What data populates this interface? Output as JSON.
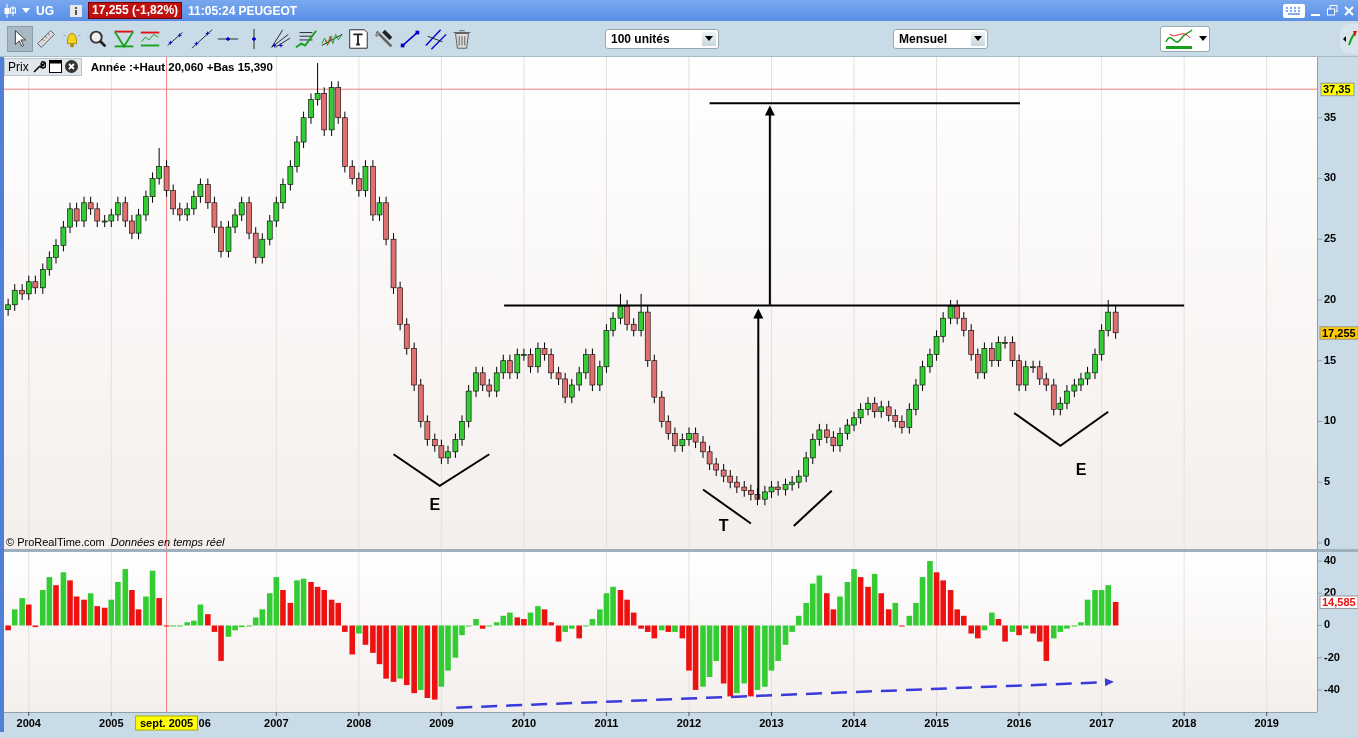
{
  "title_bar": {
    "symbol": "UG",
    "quote": "17,255 (-1,82%)",
    "time": "11:05:24",
    "name": "PEUGEOT"
  },
  "toolbar": {
    "tools": [
      {
        "kind": "pointer",
        "selected": true
      },
      {
        "kind": "ruler",
        "selected": false
      },
      {
        "kind": "alert",
        "selected": false
      },
      {
        "kind": "zoom",
        "selected": false
      },
      {
        "kind": "triangle",
        "selected": false
      },
      {
        "kind": "channel",
        "selected": false
      },
      {
        "kind": "segment",
        "selected": false
      },
      {
        "kind": "line",
        "selected": false
      },
      {
        "kind": "horizontal",
        "selected": false
      },
      {
        "kind": "vertical",
        "selected": false
      },
      {
        "kind": "fan",
        "selected": false
      },
      {
        "kind": "regression",
        "selected": false
      },
      {
        "kind": "zigzag",
        "selected": false
      },
      {
        "kind": "text",
        "selected": false
      },
      {
        "kind": "tools",
        "selected": false
      },
      {
        "kind": "point",
        "selected": false
      },
      {
        "kind": "parallel",
        "selected": false
      },
      {
        "kind": "trash",
        "selected": false
      }
    ],
    "quantity": {
      "value": "100 unités"
    },
    "period": {
      "value": "Mensuel"
    }
  },
  "price_panel": {
    "tab": "Prix",
    "info": "Année :+Haut 20,060 +Bas 15,390",
    "credit": "© ProRealTime.com",
    "credit_note": "Données en temps réel",
    "cursor_label": "37,35",
    "last_label": "17,255",
    "pattern_labels": [
      "E",
      "T",
      "E"
    ],
    "chart_data": {
      "type": "candlestick",
      "grid": true,
      "ref_lines": [
        {
          "axis": "y",
          "value": 37.35
        },
        {
          "axis": "x",
          "value": 2005.67
        },
        {
          "axis": "y",
          "value": 19.55
        }
      ],
      "xlim": [
        2003.7,
        2019.61
      ],
      "ylim": [
        -0.5,
        40
      ],
      "yticks": [
        0,
        5,
        10,
        15,
        20,
        25,
        30,
        35
      ],
      "x": [
        2003.75,
        2003.83,
        2003.92,
        2004,
        2004.08,
        2004.17,
        2004.25,
        2004.33,
        2004.42,
        2004.5,
        2004.58,
        2004.67,
        2004.75,
        2004.83,
        2004.92,
        2005,
        2005.08,
        2005.17,
        2005.25,
        2005.33,
        2005.42,
        2005.5,
        2005.58,
        2005.67,
        2005.75,
        2005.83,
        2005.92,
        2006,
        2006.08,
        2006.17,
        2006.25,
        2006.33,
        2006.42,
        2006.5,
        2006.58,
        2006.67,
        2006.75,
        2006.83,
        2006.92,
        2007,
        2007.08,
        2007.17,
        2007.25,
        2007.33,
        2007.42,
        2007.5,
        2007.58,
        2007.67,
        2007.75,
        2007.83,
        2007.92,
        2008,
        2008.08,
        2008.17,
        2008.25,
        2008.33,
        2008.42,
        2008.5,
        2008.58,
        2008.67,
        2008.75,
        2008.83,
        2008.92,
        2009,
        2009.08,
        2009.17,
        2009.25,
        2009.33,
        2009.42,
        2009.5,
        2009.58,
        2009.67,
        2009.75,
        2009.83,
        2009.92,
        2010,
        2010.08,
        2010.17,
        2010.25,
        2010.33,
        2010.42,
        2010.5,
        2010.58,
        2010.67,
        2010.75,
        2010.83,
        2010.92,
        2011,
        2011.08,
        2011.17,
        2011.25,
        2011.33,
        2011.42,
        2011.5,
        2011.58,
        2011.67,
        2011.75,
        2011.83,
        2011.92,
        2012,
        2012.08,
        2012.17,
        2012.25,
        2012.33,
        2012.42,
        2012.5,
        2012.58,
        2012.67,
        2012.75,
        2012.83,
        2012.92,
        2013,
        2013.08,
        2013.17,
        2013.25,
        2013.33,
        2013.42,
        2013.5,
        2013.58,
        2013.67,
        2013.75,
        2013.83,
        2013.92,
        2014,
        2014.08,
        2014.17,
        2014.25,
        2014.33,
        2014.42,
        2014.5,
        2014.58,
        2014.67,
        2014.75,
        2014.83,
        2014.92,
        2015,
        2015.08,
        2015.17,
        2015.25,
        2015.33,
        2015.42,
        2015.5,
        2015.58,
        2015.67,
        2015.75,
        2015.83,
        2015.92,
        2016,
        2016.08,
        2016.17,
        2016.25,
        2016.33,
        2016.42,
        2016.5,
        2016.58,
        2016.67,
        2016.75,
        2016.83,
        2016.92,
        2017,
        2017.08,
        2017.17
      ],
      "ohlc": [
        [
          19.2,
          20.1,
          18.7,
          19.6
        ],
        [
          19.6,
          21.3,
          19.1,
          20.8
        ],
        [
          20.8,
          21.3,
          20.0,
          20.5
        ],
        [
          20.5,
          22.0,
          20.0,
          21.5
        ],
        [
          21.5,
          22.0,
          20.5,
          21.0
        ],
        [
          21.0,
          23.0,
          20.5,
          22.5
        ],
        [
          22.5,
          24.0,
          22.0,
          23.5
        ],
        [
          23.5,
          25.0,
          23.0,
          24.5
        ],
        [
          24.5,
          26.5,
          24.0,
          26.0
        ],
        [
          26.0,
          28.0,
          25.5,
          27.5
        ],
        [
          27.5,
          28.0,
          26.0,
          26.5
        ],
        [
          26.5,
          28.5,
          26.0,
          28.0
        ],
        [
          28.0,
          28.5,
          27.0,
          27.5
        ],
        [
          27.5,
          28.0,
          26.0,
          26.5
        ],
        [
          26.5,
          27.0,
          26.0,
          26.5
        ],
        [
          26.5,
          27.5,
          26.0,
          27.0
        ],
        [
          27.0,
          28.5,
          26.5,
          28.0
        ],
        [
          28.0,
          28.5,
          26.0,
          26.5
        ],
        [
          26.5,
          27.0,
          25.0,
          25.5
        ],
        [
          25.5,
          27.5,
          25.0,
          27.0
        ],
        [
          27.0,
          29.0,
          26.5,
          28.5
        ],
        [
          28.5,
          30.5,
          28.0,
          30.0
        ],
        [
          30.0,
          32.5,
          29.5,
          31.0
        ],
        [
          31.0,
          31.5,
          28.5,
          29.0
        ],
        [
          29.0,
          29.5,
          27.0,
          27.5
        ],
        [
          27.5,
          28.0,
          26.5,
          27.0
        ],
        [
          27.0,
          28.0,
          26.5,
          27.5
        ],
        [
          27.5,
          29.0,
          27.0,
          28.5
        ],
        [
          28.5,
          30.0,
          28.0,
          29.5
        ],
        [
          29.5,
          30.0,
          27.5,
          28.0
        ],
        [
          28.0,
          28.5,
          25.5,
          26.0
        ],
        [
          26.0,
          26.5,
          23.5,
          24.0
        ],
        [
          24.0,
          26.5,
          23.5,
          26.0
        ],
        [
          26.0,
          27.5,
          25.5,
          27.0
        ],
        [
          27.0,
          28.5,
          26.5,
          28.0
        ],
        [
          28.0,
          28.5,
          25.0,
          25.5
        ],
        [
          25.5,
          26.0,
          23.0,
          23.5
        ],
        [
          23.5,
          25.5,
          23.0,
          25.0
        ],
        [
          25.0,
          27.0,
          24.5,
          26.5
        ],
        [
          26.5,
          28.5,
          26.0,
          28.0
        ],
        [
          28.0,
          30.0,
          27.5,
          29.5
        ],
        [
          29.5,
          31.5,
          29.0,
          31.0
        ],
        [
          31.0,
          33.5,
          30.5,
          33.0
        ],
        [
          33.0,
          35.5,
          32.5,
          35.0
        ],
        [
          35.0,
          37.0,
          34.5,
          36.5
        ],
        [
          36.5,
          39.5,
          36.0,
          37.0
        ],
        [
          37.0,
          37.5,
          33.5,
          34.0
        ],
        [
          34.0,
          38.0,
          33.5,
          37.5
        ],
        [
          37.5,
          38.0,
          34.5,
          35.0
        ],
        [
          35.0,
          35.5,
          30.5,
          31.0
        ],
        [
          31.0,
          31.5,
          29.5,
          30.0
        ],
        [
          30.0,
          30.5,
          28.5,
          29.0
        ],
        [
          29.0,
          31.5,
          28.5,
          31.0
        ],
        [
          31.0,
          31.5,
          26.5,
          27.0
        ],
        [
          27.0,
          28.5,
          26.5,
          28.0
        ],
        [
          28.0,
          28.5,
          24.5,
          25.0
        ],
        [
          25.0,
          25.5,
          20.5,
          21.0
        ],
        [
          21.0,
          21.5,
          17.5,
          18.0
        ],
        [
          18.0,
          18.5,
          15.5,
          16.0
        ],
        [
          16.0,
          16.5,
          12.5,
          13.0
        ],
        [
          13.0,
          13.5,
          9.5,
          10.0
        ],
        [
          10.0,
          10.5,
          8.0,
          8.5
        ],
        [
          8.5,
          9.0,
          7.5,
          8.0
        ],
        [
          8.0,
          8.5,
          6.5,
          7.0
        ],
        [
          7.0,
          8.0,
          6.5,
          7.5
        ],
        [
          7.5,
          9.0,
          7.0,
          8.5
        ],
        [
          8.5,
          10.5,
          8.0,
          10.0
        ],
        [
          10.0,
          13.0,
          9.5,
          12.5
        ],
        [
          12.5,
          14.5,
          12.0,
          14.0
        ],
        [
          14.0,
          14.5,
          12.5,
          13.0
        ],
        [
          13.0,
          13.5,
          12.0,
          12.5
        ],
        [
          12.5,
          14.5,
          12.0,
          14.0
        ],
        [
          14.0,
          15.5,
          13.5,
          15.0
        ],
        [
          15.0,
          15.5,
          13.5,
          14.0
        ],
        [
          14.0,
          16.0,
          13.5,
          15.5
        ],
        [
          15.5,
          16.0,
          15.0,
          15.5
        ],
        [
          15.5,
          16.0,
          14.0,
          14.5
        ],
        [
          14.5,
          16.5,
          14.0,
          16.0
        ],
        [
          16.0,
          16.5,
          15.0,
          15.5
        ],
        [
          15.5,
          16.0,
          13.5,
          14.0
        ],
        [
          14.0,
          14.5,
          13.0,
          13.5
        ],
        [
          13.5,
          14.0,
          11.5,
          12.0
        ],
        [
          12.0,
          13.5,
          11.5,
          13.0
        ],
        [
          13.0,
          14.5,
          12.5,
          14.0
        ],
        [
          14.0,
          16.0,
          13.5,
          15.5
        ],
        [
          15.5,
          16.0,
          12.5,
          13.0
        ],
        [
          13.0,
          15.0,
          12.5,
          14.5
        ],
        [
          14.5,
          18.0,
          14.0,
          17.5
        ],
        [
          17.5,
          19.0,
          17.0,
          18.5
        ],
        [
          18.5,
          20.5,
          18.0,
          19.5
        ],
        [
          19.5,
          20.0,
          17.5,
          18.0
        ],
        [
          18.0,
          18.5,
          17.0,
          17.5
        ],
        [
          17.5,
          20.5,
          17.0,
          19.0
        ],
        [
          19.0,
          19.5,
          14.5,
          15.0
        ],
        [
          15.0,
          15.5,
          11.5,
          12.0
        ],
        [
          12.0,
          12.5,
          9.5,
          10.0
        ],
        [
          10.0,
          10.5,
          8.5,
          9.0
        ],
        [
          9.0,
          9.5,
          7.5,
          8.0
        ],
        [
          8.0,
          9.0,
          7.5,
          8.5
        ],
        [
          8.5,
          9.5,
          8.0,
          9.0
        ],
        [
          9.0,
          9.5,
          7.8,
          8.3
        ],
        [
          8.3,
          8.8,
          7.0,
          7.5
        ],
        [
          7.5,
          8.0,
          6.0,
          6.5
        ],
        [
          6.5,
          7.0,
          5.5,
          6.0
        ],
        [
          6.0,
          6.5,
          5.0,
          5.5
        ],
        [
          5.5,
          6.0,
          4.5,
          5.0
        ],
        [
          5.0,
          5.5,
          4.1,
          4.6
        ],
        [
          4.6,
          5.1,
          3.8,
          4.3
        ],
        [
          4.3,
          4.8,
          3.5,
          4.0
        ],
        [
          4.0,
          4.5,
          3.1,
          3.6
        ],
        [
          3.6,
          4.7,
          3.1,
          4.2
        ],
        [
          4.2,
          5.1,
          3.7,
          4.6
        ],
        [
          4.6,
          5.1,
          3.9,
          4.4
        ],
        [
          4.4,
          5.3,
          3.9,
          4.8
        ],
        [
          4.8,
          5.5,
          4.3,
          5.0
        ],
        [
          5.0,
          6.0,
          4.5,
          5.5
        ],
        [
          5.5,
          7.5,
          5.0,
          7.0
        ],
        [
          7.0,
          9.0,
          6.5,
          8.5
        ],
        [
          8.5,
          9.8,
          8.0,
          9.3
        ],
        [
          9.3,
          9.8,
          8.2,
          8.7
        ],
        [
          8.7,
          9.2,
          7.5,
          8.0
        ],
        [
          8.0,
          9.5,
          7.5,
          9.0
        ],
        [
          9.0,
          10.2,
          8.5,
          9.7
        ],
        [
          9.7,
          10.8,
          9.2,
          10.3
        ],
        [
          10.3,
          11.5,
          9.8,
          11.0
        ],
        [
          11.0,
          12.0,
          10.5,
          11.5
        ],
        [
          11.5,
          12.0,
          10.3,
          10.8
        ],
        [
          10.8,
          11.7,
          10.3,
          11.2
        ],
        [
          11.2,
          11.7,
          10.0,
          10.5
        ],
        [
          10.5,
          11.0,
          9.5,
          10.0
        ],
        [
          10.0,
          10.5,
          9.0,
          9.5
        ],
        [
          9.5,
          11.5,
          9.0,
          11.0
        ],
        [
          11.0,
          13.5,
          10.5,
          13.0
        ],
        [
          13.0,
          15.0,
          12.5,
          14.5
        ],
        [
          14.5,
          16.0,
          14.0,
          15.5
        ],
        [
          15.5,
          17.5,
          15.0,
          17.0
        ],
        [
          17.0,
          19.0,
          16.5,
          18.5
        ],
        [
          18.5,
          20.0,
          18.0,
          19.5
        ],
        [
          19.5,
          20.0,
          18.0,
          18.5
        ],
        [
          18.5,
          19.0,
          17.0,
          17.5
        ],
        [
          17.5,
          18.0,
          15.0,
          15.5
        ],
        [
          15.5,
          16.0,
          13.5,
          14.0
        ],
        [
          14.0,
          16.5,
          13.5,
          16.0
        ],
        [
          16.0,
          16.5,
          14.5,
          15.0
        ],
        [
          15.0,
          17.0,
          14.5,
          16.5
        ],
        [
          16.5,
          17.0,
          16.0,
          16.5
        ],
        [
          16.5,
          17.0,
          14.5,
          15.0
        ],
        [
          15.0,
          15.5,
          12.5,
          13.0
        ],
        [
          13.0,
          15.0,
          12.5,
          14.5
        ],
        [
          14.5,
          15.0,
          14.0,
          14.5
        ],
        [
          14.5,
          15.0,
          13.0,
          13.5
        ],
        [
          13.5,
          14.0,
          12.5,
          13.0
        ],
        [
          13.0,
          13.5,
          10.5,
          11.0
        ],
        [
          11.0,
          12.0,
          10.5,
          11.5
        ],
        [
          11.5,
          13.0,
          11.0,
          12.5
        ],
        [
          12.5,
          13.5,
          12.0,
          13.0
        ],
        [
          13.0,
          14.0,
          12.5,
          13.5
        ],
        [
          13.5,
          14.5,
          13.0,
          14.0
        ],
        [
          14.0,
          16.0,
          13.5,
          15.5
        ],
        [
          15.5,
          18.0,
          15.0,
          17.5
        ],
        [
          17.5,
          20.0,
          17.0,
          19.0
        ],
        [
          19.0,
          19.5,
          16.8,
          17.3
        ]
      ]
    }
  },
  "indicator_panel": {
    "last_label": "14,585",
    "chart_data": {
      "type": "bar",
      "grid": true,
      "ref_lines": [
        {
          "axis": "x",
          "value": 2005.67
        }
      ],
      "xlim": [
        2003.7,
        2019.61
      ],
      "ylim": [
        -53.7,
        45.6
      ],
      "yticks": [
        40,
        20,
        0,
        -20,
        -40
      ],
      "xticks": [
        {
          "value": 2004,
          "label": "2004"
        },
        {
          "value": 2005,
          "label": "2005"
        },
        {
          "value": 2007,
          "label": "2007"
        },
        {
          "value": 2008,
          "label": "2008"
        },
        {
          "value": 2009,
          "label": "2009"
        },
        {
          "value": 2010,
          "label": "2010"
        },
        {
          "value": 2011,
          "label": "2011"
        },
        {
          "value": 2012,
          "label": "2012"
        },
        {
          "value": 2013,
          "label": "2013"
        },
        {
          "value": 2014,
          "label": "2014"
        },
        {
          "value": 2015,
          "label": "2015"
        },
        {
          "value": 2016,
          "label": "2016"
        },
        {
          "value": 2017,
          "label": "2017"
        },
        {
          "value": 2018,
          "label": "2018"
        },
        {
          "value": 2019,
          "label": "2019"
        }
      ],
      "x": [
        2003.75,
        2003.83,
        2003.92,
        2004,
        2004.08,
        2004.17,
        2004.25,
        2004.33,
        2004.42,
        2004.5,
        2004.58,
        2004.67,
        2004.75,
        2004.83,
        2004.92,
        2005,
        2005.08,
        2005.17,
        2005.25,
        2005.33,
        2005.42,
        2005.5,
        2005.58,
        2005.67,
        2005.75,
        2005.83,
        2005.92,
        2006,
        2006.08,
        2006.17,
        2006.25,
        2006.33,
        2006.42,
        2006.5,
        2006.58,
        2006.67,
        2006.75,
        2006.83,
        2006.92,
        2007,
        2007.08,
        2007.17,
        2007.25,
        2007.33,
        2007.42,
        2007.5,
        2007.58,
        2007.67,
        2007.75,
        2007.83,
        2007.92,
        2008,
        2008.08,
        2008.17,
        2008.25,
        2008.33,
        2008.42,
        2008.5,
        2008.58,
        2008.67,
        2008.75,
        2008.83,
        2008.92,
        2009,
        2009.08,
        2009.17,
        2009.25,
        2009.33,
        2009.42,
        2009.5,
        2009.58,
        2009.67,
        2009.75,
        2009.83,
        2009.92,
        2010,
        2010.08,
        2010.17,
        2010.25,
        2010.33,
        2010.42,
        2010.5,
        2010.58,
        2010.67,
        2010.75,
        2010.83,
        2010.92,
        2011,
        2011.08,
        2011.17,
        2011.25,
        2011.33,
        2011.42,
        2011.5,
        2011.58,
        2011.67,
        2011.75,
        2011.83,
        2011.92,
        2012,
        2012.08,
        2012.17,
        2012.25,
        2012.33,
        2012.42,
        2012.5,
        2012.58,
        2012.67,
        2012.75,
        2012.83,
        2012.92,
        2013,
        2013.08,
        2013.17,
        2013.25,
        2013.33,
        2013.42,
        2013.5,
        2013.58,
        2013.67,
        2013.75,
        2013.83,
        2013.92,
        2014,
        2014.08,
        2014.17,
        2014.25,
        2014.33,
        2014.42,
        2014.5,
        2014.58,
        2014.67,
        2014.75,
        2014.83,
        2014.92,
        2015,
        2015.08,
        2015.17,
        2015.25,
        2015.33,
        2015.42,
        2015.5,
        2015.58,
        2015.67,
        2015.75,
        2015.83,
        2015.92,
        2016,
        2016.08,
        2016.17,
        2016.25,
        2016.33,
        2016.42,
        2016.5,
        2016.58,
        2016.67,
        2016.75,
        2016.83,
        2016.92,
        2017,
        2017.08,
        2017.17
      ],
      "series": [
        {
          "values": [
            -3,
            10,
            17,
            13,
            -1,
            22,
            30,
            25,
            33,
            28,
            18,
            16,
            20,
            12,
            11,
            16,
            27,
            35,
            22,
            10,
            18,
            34,
            17,
            0,
            0,
            0,
            2,
            3,
            13,
            7,
            -4,
            -22,
            -7,
            -3,
            -1,
            0,
            5,
            10,
            20,
            30,
            22,
            14,
            28,
            29,
            27,
            24,
            22,
            16,
            14,
            -4,
            -18,
            -5,
            -12,
            -17,
            -24,
            -33,
            -35,
            -33,
            -37,
            -42,
            -40,
            -45,
            -46,
            -38,
            -28,
            -20,
            -6,
            0,
            4,
            -2,
            0,
            2,
            6,
            8,
            5,
            4,
            8,
            12,
            10,
            2,
            -10,
            -4,
            -2,
            -8,
            0,
            4,
            10,
            20,
            24,
            22,
            16,
            8,
            -2,
            -4,
            -8,
            -3,
            -4,
            -4,
            -8,
            -28,
            -40,
            -38,
            -32,
            -22,
            -36,
            -44,
            -42,
            -36,
            -44,
            -40,
            -38,
            -28,
            -22,
            -12,
            -4,
            6,
            14,
            26,
            31,
            20,
            10,
            18,
            27,
            35,
            30,
            24,
            32,
            20,
            10,
            14,
            0,
            6,
            14,
            30,
            40,
            33,
            28,
            22,
            10,
            6,
            -5,
            -8,
            -3,
            8,
            4,
            -10,
            -4,
            -6,
            -2,
            -5,
            -10,
            -22,
            -8,
            -4,
            -2,
            0,
            2,
            16,
            22,
            22,
            25,
            14.6
          ]
        }
      ]
    }
  },
  "x_axis": {
    "cursor_label": "sept. 2005",
    "partial_tick_label": "06"
  }
}
